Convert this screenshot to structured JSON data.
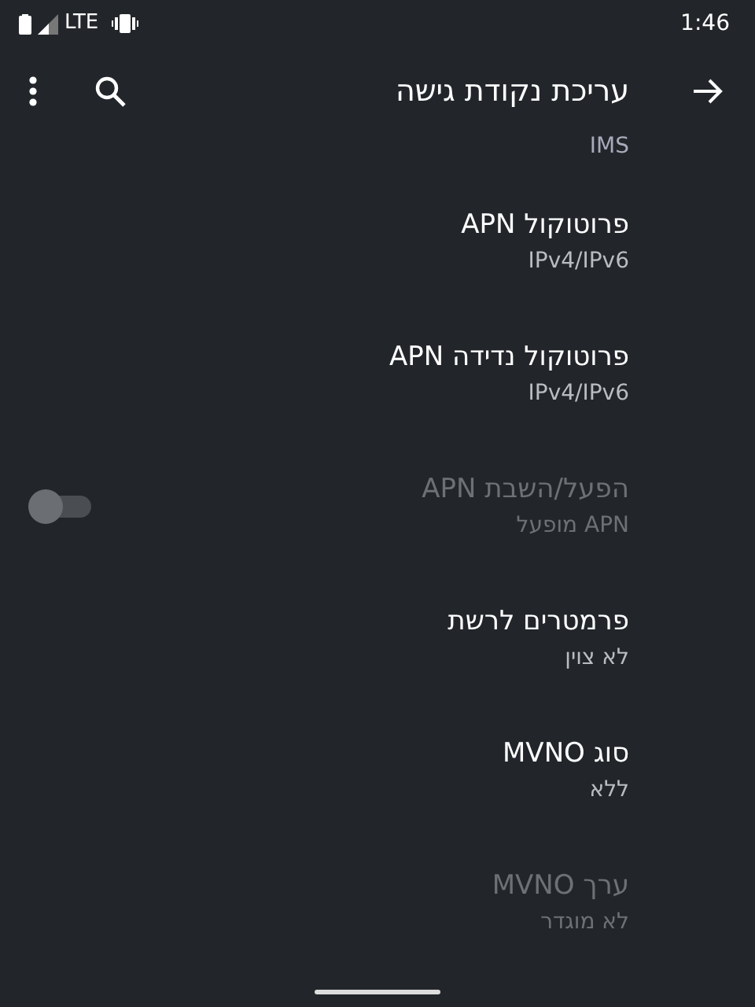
{
  "status_bar": {
    "network": "LTE",
    "time": "1:46"
  },
  "toolbar": {
    "title": "עריכת נקודת גישה"
  },
  "clipped_summary": "IMS",
  "settings": [
    {
      "kind": "text",
      "title": "פרוטוקול APN",
      "summary": "IPv4/IPv6",
      "disabled": false
    },
    {
      "kind": "text",
      "title": "פרוטוקול נדידה APN",
      "summary": "IPv4/IPv6",
      "disabled": false
    },
    {
      "kind": "switch",
      "title": "הפעל/השבת APN",
      "summary": "APN מופעל",
      "disabled": true,
      "on": false
    },
    {
      "kind": "text",
      "title": "פרמטרים לרשת",
      "summary": "לא צוין",
      "disabled": false
    },
    {
      "kind": "text",
      "title": "סוג MVNO",
      "summary": "ללא",
      "disabled": false
    },
    {
      "kind": "text",
      "title": "ערך MVNO",
      "summary": "לא מוגדר",
      "disabled": true
    }
  ]
}
